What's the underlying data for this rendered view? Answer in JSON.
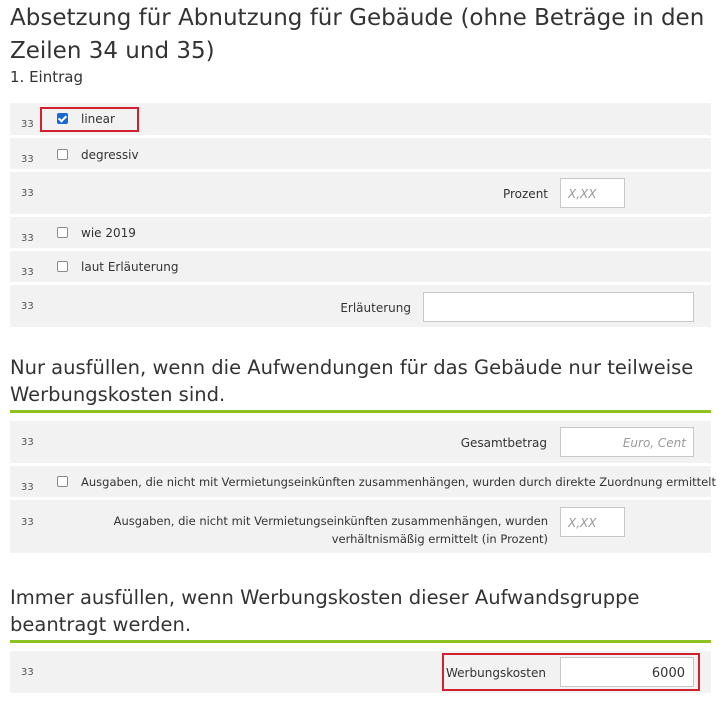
{
  "section1": {
    "title": "Absetzung für Abnutzung für Gebäude (ohne Beträge in den Zeilen 34 und 35)",
    "subtitle": "1. Eintrag",
    "rows": {
      "linear": {
        "num": "33",
        "label": "linear",
        "checked": true
      },
      "degressiv": {
        "num": "33",
        "label": "degressiv",
        "checked": false
      },
      "prozent": {
        "num": "33",
        "label": "Prozent",
        "placeholder": "X,XX"
      },
      "wie2019": {
        "num": "33",
        "label": "wie 2019",
        "checked": false
      },
      "lautErl": {
        "num": "33",
        "label": "laut Erläuterung",
        "checked": false
      },
      "erlaeuterung": {
        "num": "33",
        "label": "Erläuterung",
        "value": ""
      }
    }
  },
  "section2": {
    "title": "Nur ausfüllen, wenn die Aufwendungen für das Gebäude nur teilweise Werbungskosten sind.",
    "rows": {
      "gesamtbetrag": {
        "num": "33",
        "label": "Gesamtbetrag",
        "placeholder": "Euro, Cent"
      },
      "direkt": {
        "num": "33",
        "label": "Ausgaben, die nicht mit Vermietungseinkünften zusammenhängen, wurden durch direkte Zuordnung ermittelt",
        "checked": false
      },
      "verhaeltnis": {
        "num": "33",
        "label_line1": "Ausgaben, die nicht mit Vermietungseinkünften zusammenhängen, wurden",
        "label_line2": "verhältnismäßig ermittelt (in Prozent)",
        "placeholder": "X,XX"
      }
    }
  },
  "section3": {
    "title": "Immer ausfüllen, wenn Werbungskosten dieser Aufwandsgruppe beantragt werden.",
    "rows": {
      "werbungskosten": {
        "num": "33",
        "label": "Werbungskosten",
        "value": "6000"
      }
    }
  },
  "colors": {
    "accent_green": "#8ec31f",
    "highlight_red": "#d3202f",
    "checkbox_blue": "#1769d3",
    "row_bg": "#f2f2f2"
  }
}
